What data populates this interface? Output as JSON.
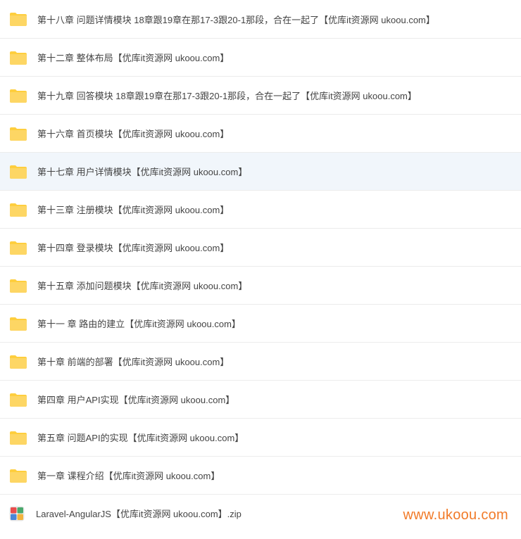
{
  "items": [
    {
      "name": "第十八章 问题详情模块 18章跟19章在那17-3跟20-1那段，合在一起了【优库it资源网 ukoou.com】",
      "type": "folder",
      "highlighted": false
    },
    {
      "name": "第十二章 整体布局【优库it资源网 ukoou.com】",
      "type": "folder",
      "highlighted": false
    },
    {
      "name": "第十九章 回答模块 18章跟19章在那17-3跟20-1那段，合在一起了【优库it资源网 ukoou.com】",
      "type": "folder",
      "highlighted": false
    },
    {
      "name": "第十六章 首页模块【优库it资源网 ukoou.com】",
      "type": "folder",
      "highlighted": false
    },
    {
      "name": "第十七章 用户详情模块【优库it资源网 ukoou.com】",
      "type": "folder",
      "highlighted": true
    },
    {
      "name": "第十三章 注册模块【优库it资源网 ukoou.com】",
      "type": "folder",
      "highlighted": false
    },
    {
      "name": "第十四章 登录模块【优库it资源网 ukoou.com】",
      "type": "folder",
      "highlighted": false
    },
    {
      "name": "第十五章 添加问题模块【优库it资源网 ukoou.com】",
      "type": "folder",
      "highlighted": false
    },
    {
      "name": "第十一 章 路由的建立【优库it资源网 ukoou.com】",
      "type": "folder",
      "highlighted": false
    },
    {
      "name": "第十章 前端的部署【优库it资源网 ukoou.com】",
      "type": "folder",
      "highlighted": false
    },
    {
      "name": "第四章 用户API实现【优库it资源网 ukoou.com】",
      "type": "folder",
      "highlighted": false
    },
    {
      "name": "第五章 问题API的实现【优库it资源网 ukoou.com】",
      "type": "folder",
      "highlighted": false
    },
    {
      "name": "第一章 课程介绍【优库it资源网 ukoou.com】",
      "type": "folder",
      "highlighted": false
    },
    {
      "name": "Laravel-AngularJS【优库it资源网 ukoou.com】.zip",
      "type": "zip",
      "highlighted": false
    }
  ],
  "watermark": "www.ukoou.com"
}
